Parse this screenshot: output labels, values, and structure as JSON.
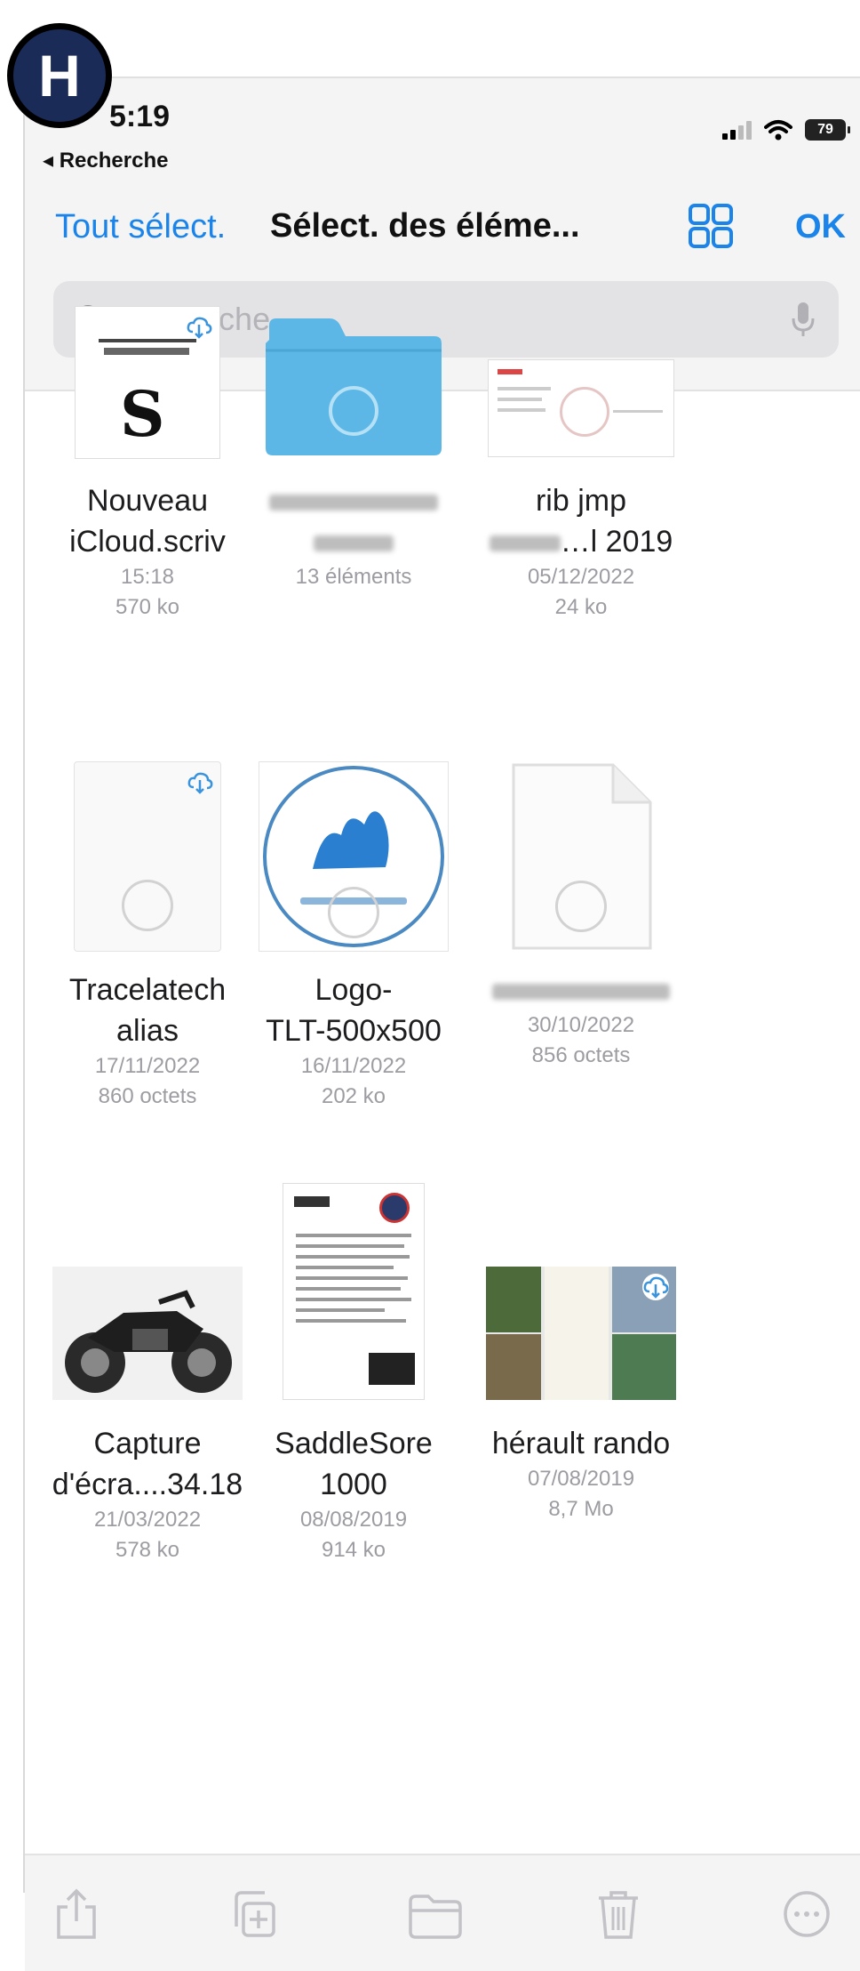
{
  "badge": {
    "letter": "H"
  },
  "status_bar": {
    "time": "5:19",
    "back_label": "◂ Recherche",
    "battery": "79"
  },
  "nav": {
    "select_all": "Tout sélect.",
    "title": "Sélect. des éléme...",
    "ok": "OK"
  },
  "search": {
    "placeholder": "Recherche"
  },
  "files": [
    {
      "name_line1": "Nouveau",
      "name_line2": "iCloud.scriv",
      "date": "15:18",
      "size": "570 ko",
      "thumb": "scrivener-doc",
      "icloud": true
    },
    {
      "name_line1": "",
      "name_line2": "",
      "date": "13 éléments",
      "size": "",
      "thumb": "folder",
      "name_blurred": true
    },
    {
      "name_line1": "rib jmp",
      "name_line2": "…l 2019",
      "date": "05/12/2022",
      "size": "24 ko",
      "thumb": "document-preview"
    },
    {
      "name_line1": "Tracelatech",
      "name_line2": "alias",
      "date": "17/11/2022",
      "size": "860 octets",
      "thumb": "alias-file",
      "icloud": true
    },
    {
      "name_line1": "Logo-",
      "name_line2": "TLT-500x500",
      "date": "16/11/2022",
      "size": "202 ko",
      "thumb": "logo-image"
    },
    {
      "name_line1": "",
      "name_line2": "",
      "date": "30/10/2022",
      "size": "856 octets",
      "thumb": "blank-doc",
      "name_blurred": true
    },
    {
      "name_line1": "Capture",
      "name_line2": "d'écra....34.18",
      "date": "21/03/2022",
      "size": "578 ko",
      "thumb": "motorcycle-photo"
    },
    {
      "name_line1": "SaddleSore",
      "name_line2": "1000",
      "date": "08/08/2019",
      "size": "914 ko",
      "thumb": "document-preview"
    },
    {
      "name_line1": "hérault rando",
      "name_line2": "",
      "date": "07/08/2019",
      "size": "8,7 Mo",
      "thumb": "photo-collage",
      "icloud": true
    }
  ],
  "toolbar": {
    "icons": [
      "share-icon",
      "duplicate-icon",
      "move-folder-icon",
      "trash-icon",
      "more-icon"
    ]
  },
  "colors": {
    "accent": "#1a84ea",
    "folder": "#5cb7e6",
    "background": "#f4f4f5"
  }
}
